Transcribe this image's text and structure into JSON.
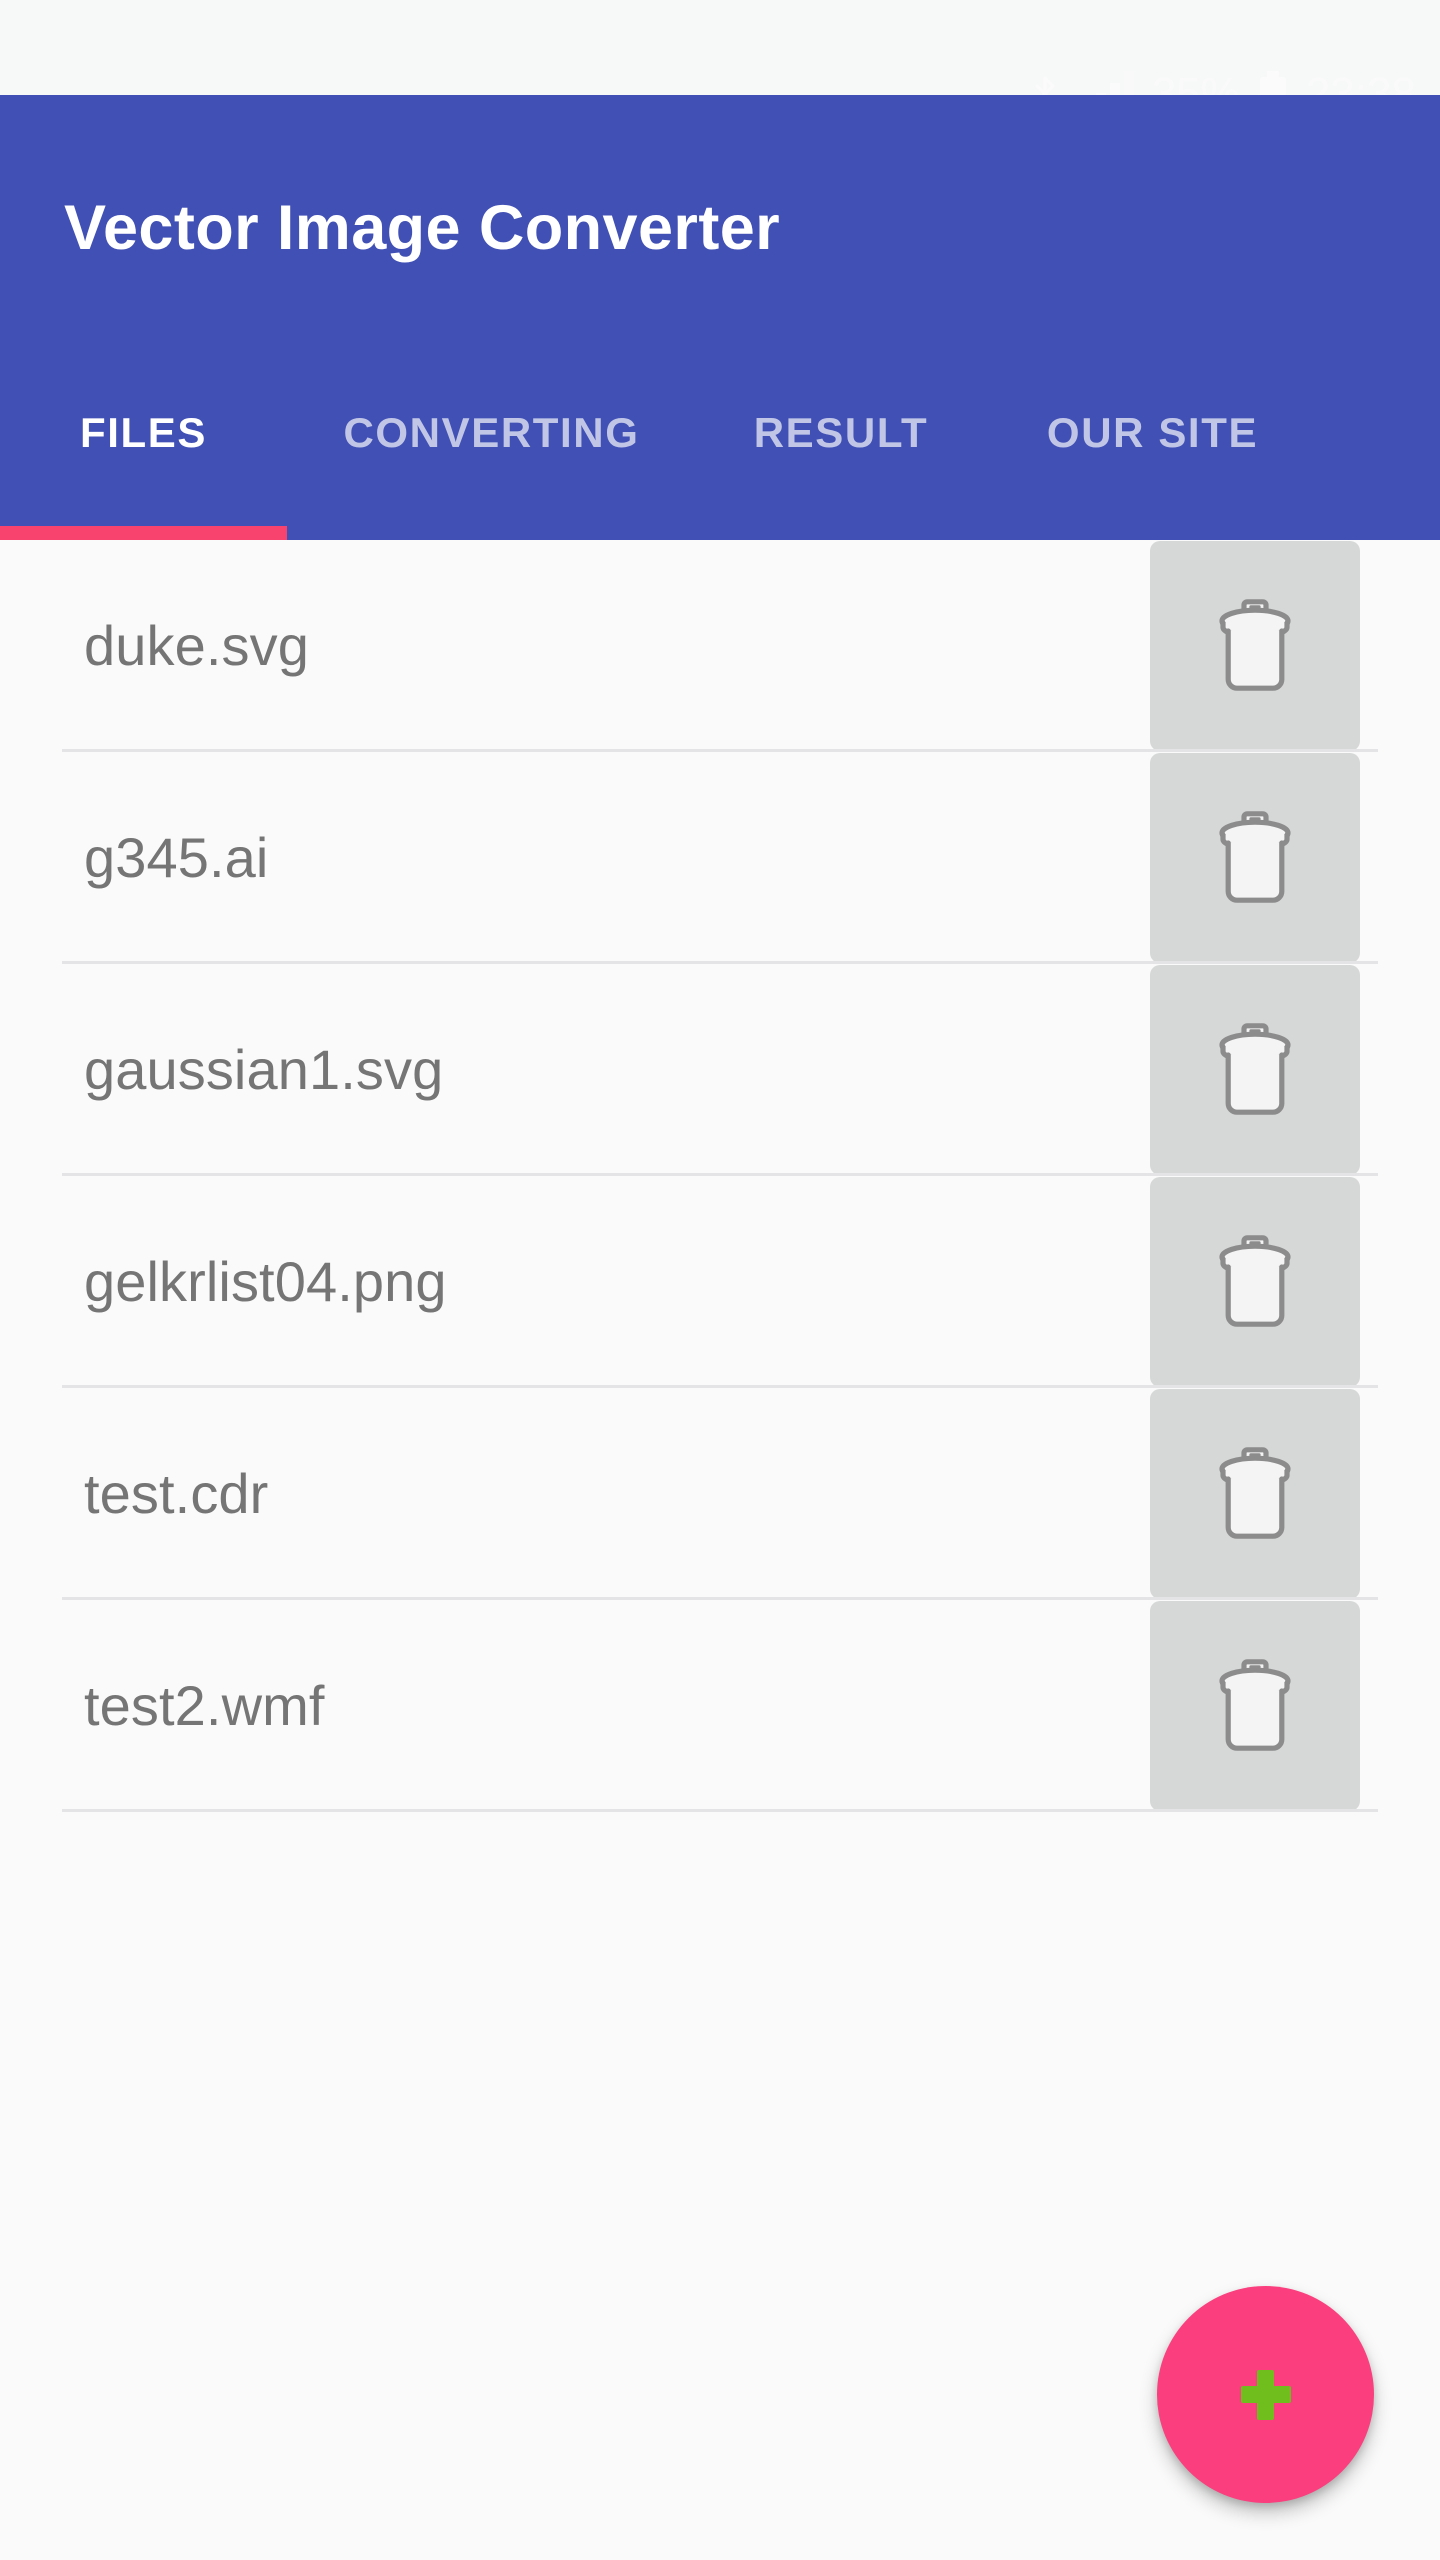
{
  "status_bar": {
    "icons": [
      {
        "name": "bluetooth-icon",
        "glyph": "bluetooth"
      },
      {
        "name": "signal-bars-icon",
        "glyph": "signal"
      }
    ],
    "battery_percent": "35%",
    "battery_icon": "battery-icon",
    "clock": "23:38",
    "background_color": "#F7F8F8",
    "text_color": "#FBFBFC"
  },
  "app_bar": {
    "title": "Vector Image Converter",
    "background_color": "#4050B5",
    "title_color": "#FFFFFF"
  },
  "tabs": {
    "indicator_color": "#F8436F",
    "active_index": 0,
    "items": [
      {
        "label": "FILES",
        "name": "tab-files"
      },
      {
        "label": "CONVERTING",
        "name": "tab-converting"
      },
      {
        "label": "RESULT",
        "name": "tab-result"
      },
      {
        "label": "OUR SITE",
        "name": "tab-our-site"
      }
    ]
  },
  "file_list": {
    "row_background": "#FAFAFA",
    "divider_color": "#E4E4E6",
    "filename_color": "#757575",
    "delete_button_color": "#D6D7D7",
    "delete_icon_name": "trash-icon",
    "items": [
      {
        "filename": "duke.svg"
      },
      {
        "filename": "g345.ai"
      },
      {
        "filename": "gaussian1.svg"
      },
      {
        "filename": "gelkrlist04.png"
      },
      {
        "filename": "test.cdr"
      },
      {
        "filename": "test2.wmf"
      }
    ]
  },
  "fab": {
    "icon_name": "plus-icon",
    "background_color": "#FA3E7E",
    "icon_color": "#6FBE1E",
    "label": "+"
  }
}
